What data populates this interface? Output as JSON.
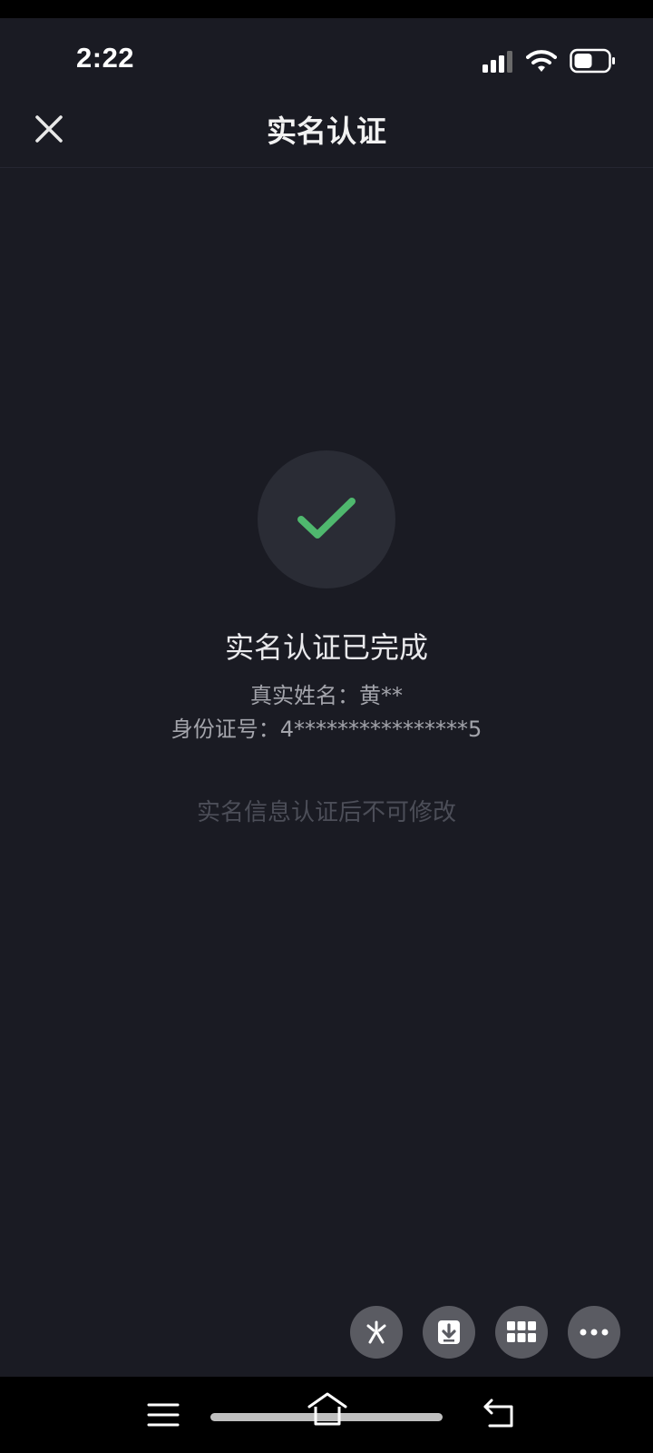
{
  "status_bar": {
    "time": "2:22",
    "icons": [
      "signal-icon",
      "wifi-icon",
      "battery-icon"
    ]
  },
  "header": {
    "title": "实名认证",
    "close_icon": "close-icon"
  },
  "result": {
    "icon": "check-icon",
    "title": "实名认证已完成",
    "name_line": "真实姓名：黄**",
    "id_line": "身份证号：4****************5",
    "notice": "实名信息认证后不可修改"
  },
  "toolbar": {
    "icons": [
      "sparkle-icon",
      "download-icon",
      "grid-icon",
      "more-icon"
    ]
  },
  "nav": {
    "icons": [
      "menu-icon",
      "home-icon",
      "back-icon"
    ]
  },
  "colors": {
    "background": "#1a1b23",
    "accent_check": "#4fb86e",
    "circle": "#2a2c35"
  }
}
